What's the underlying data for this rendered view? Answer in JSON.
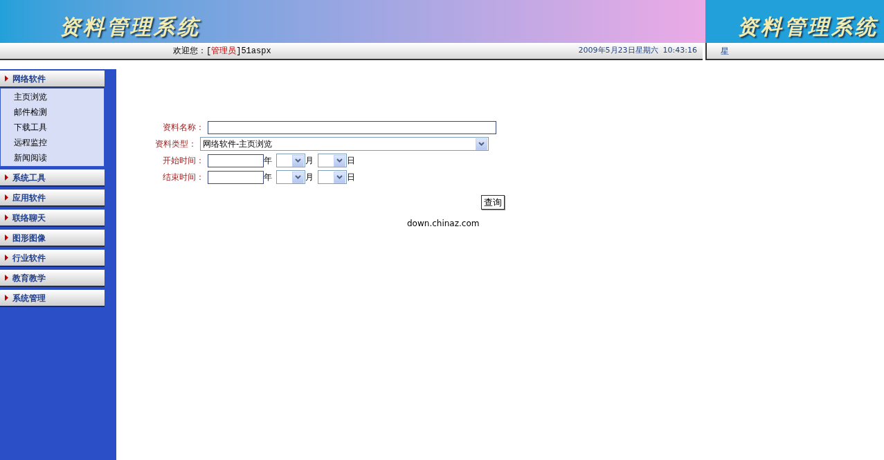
{
  "header": {
    "logo": "资料管理系统",
    "right_logo": "资料管理系统"
  },
  "status_bar": {
    "welcome_prefix": "欢迎您：[",
    "role": "管理员",
    "welcome_suffix": "]51aspx",
    "datetime": "2009年5月23日星期六  10:43:16",
    "right_text": "星"
  },
  "sidebar": {
    "groups": [
      {
        "label": "网络软件",
        "expanded": true,
        "children": [
          {
            "label": "主页浏览"
          },
          {
            "label": "邮件检测"
          },
          {
            "label": "下载工具"
          },
          {
            "label": "远程监控"
          },
          {
            "label": "新闻阅读"
          }
        ]
      },
      {
        "label": "系统工具",
        "expanded": false
      },
      {
        "label": "应用软件",
        "expanded": false
      },
      {
        "label": "联络聊天",
        "expanded": false
      },
      {
        "label": "图形图像",
        "expanded": false
      },
      {
        "label": "行业软件",
        "expanded": false
      },
      {
        "label": "教育教学",
        "expanded": false
      },
      {
        "label": "系统管理",
        "expanded": false
      }
    ]
  },
  "form": {
    "name_label": "资料名称：",
    "type_label": "资料类型：",
    "type_value": "网络软件-主页浏览",
    "dates": [
      {
        "label": "开始时间：",
        "year_unit": "年",
        "month_unit": "月",
        "day_unit": "日"
      },
      {
        "label": "结束时间：",
        "year_unit": "年",
        "month_unit": "月",
        "day_unit": "日"
      }
    ],
    "search_button": "查询"
  },
  "footer": "down.chinaz.com"
}
